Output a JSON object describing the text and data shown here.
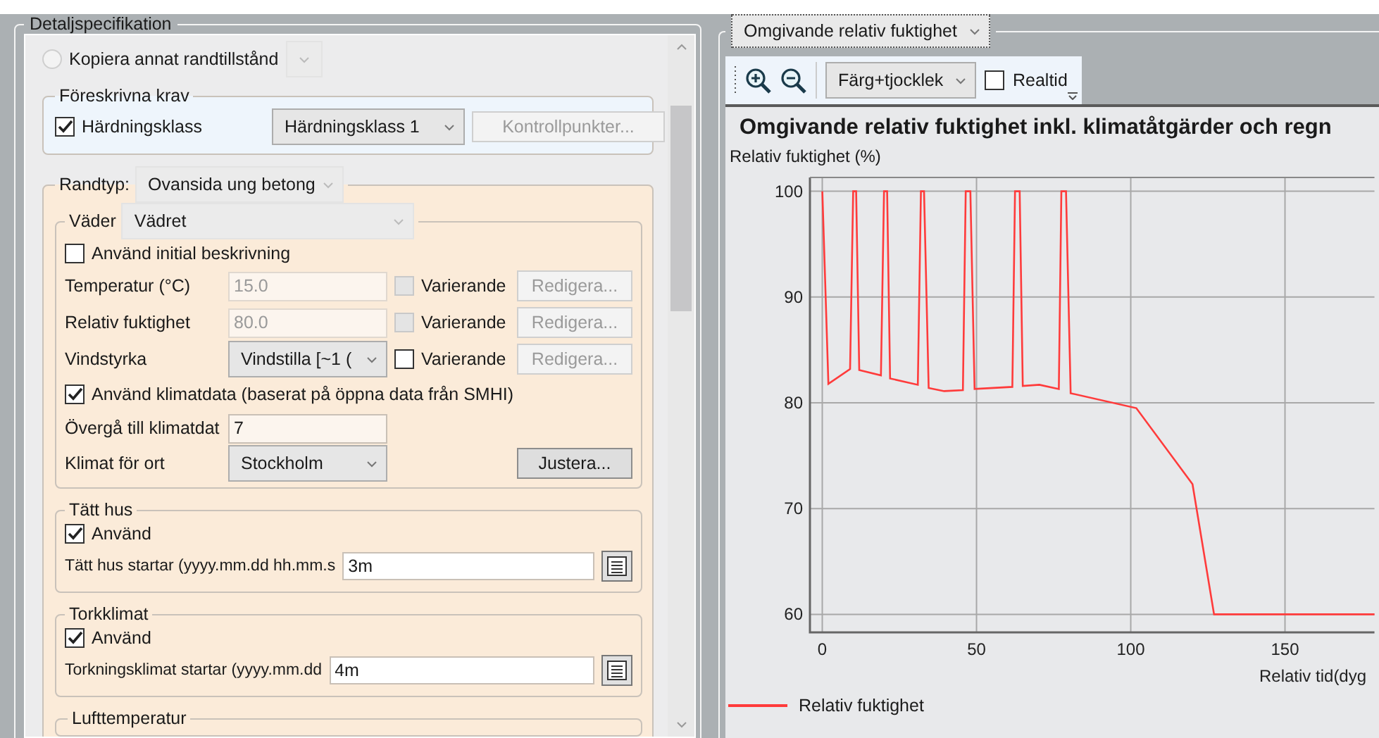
{
  "left_panel": {
    "title": "Detaljspecifikation",
    "copy_option": {
      "label": "Kopiera annat randtillstånd",
      "selected": false,
      "disabled": true
    },
    "prescribed": {
      "title": "Föreskrivna krav",
      "checkbox": {
        "label": "Härdningsklass",
        "checked": true
      },
      "class_select": "Härdningsklass 1",
      "button": {
        "label": "Kontrollpunkter...",
        "disabled": true
      }
    },
    "boundary": {
      "label": "Randtyp:",
      "select": "Ovansida ung betong",
      "weather": {
        "label": "Väder",
        "select": "Vädret",
        "initial": {
          "label": "Använd initial beskrivning",
          "checked": false
        },
        "rows": [
          {
            "kind": "input",
            "label": "Temperatur (°C)",
            "value": "15.0",
            "disabled": true,
            "varying": {
              "label": "Varierande",
              "checked": false,
              "disabled": true
            },
            "edit": {
              "label": "Redigera...",
              "disabled": true
            }
          },
          {
            "kind": "input",
            "label": "Relativ fuktighet",
            "value": "80.0",
            "disabled": true,
            "varying": {
              "label": "Varierande",
              "checked": false,
              "disabled": true
            },
            "edit": {
              "label": "Redigera...",
              "disabled": true
            }
          },
          {
            "kind": "select",
            "label": "Vindstyrka",
            "value": "Vindstilla [~1 (",
            "disabled": false,
            "varying": {
              "label": "Varierande",
              "checked": false,
              "disabled": false
            },
            "edit": {
              "label": "Redigera...",
              "disabled": true
            }
          }
        ],
        "climate_data": {
          "label": "Använd klimatdata (baserat på öppna data från SMHI)",
          "checked": true
        },
        "transition": {
          "label": "Övergå till klimatdat",
          "value": "7"
        },
        "location": {
          "label": "Klimat för ort",
          "select": "Stockholm",
          "button": "Justera..."
        }
      },
      "sections": [
        {
          "title": "Tätt hus",
          "use": {
            "label": "Använd",
            "checked": true
          },
          "start": {
            "label": "Tätt hus startar (yyyy.mm.dd hh.mm.s",
            "value": "3m"
          }
        },
        {
          "title": "Torkklimat",
          "use": {
            "label": "Använd",
            "checked": true
          },
          "start": {
            "label": "Torkningsklimat startar (yyyy.mm.dd",
            "value": "4m"
          }
        }
      ],
      "sub_group": "Lufttemperatur"
    }
  },
  "right_panel": {
    "view_select": "Omgivande relativ fuktighet",
    "toolbar": {
      "mode_select": "Färg+tjocklek",
      "realtime": {
        "label": "Realtid",
        "checked": false
      }
    },
    "chart": {
      "title": "Omgivande relativ fuktighet inkl. klimatåtgärder och regn",
      "chart_data": {
        "type": "line",
        "grid": true,
        "ylabel": "Relativ fuktighet (%)",
        "xlabel": "Relativ tid(dyg",
        "xlim": [
          -4,
          179
        ],
        "ylim": [
          58.3,
          101.3
        ],
        "xticks": [
          0,
          50,
          100,
          150
        ],
        "yticks": [
          60,
          70,
          80,
          90,
          100
        ],
        "x": [
          0,
          2,
          9,
          10,
          11,
          12,
          19,
          20,
          21,
          22,
          31,
          32,
          33,
          34.5,
          39.5,
          45.6,
          46.5,
          48,
          49.4,
          61.6,
          62.5,
          64,
          65,
          70.4,
          76.7,
          77.5,
          79,
          80.5,
          101.8,
          120,
          127,
          179
        ],
        "series": [
          {
            "name": "Relativ fuktighet",
            "color": "#ff3b3b",
            "values": [
              100,
              81.8,
              83.2,
              100,
              100,
              83.1,
              82.6,
              100,
              100,
              82.3,
              81.7,
              100,
              100,
              81.4,
              81.1,
              81.2,
              100,
              100,
              81.3,
              81.5,
              100,
              100,
              81.6,
              81.7,
              81.3,
              100,
              100,
              80.9,
              79.5,
              72.3,
              60,
              60
            ]
          }
        ]
      }
    }
  }
}
